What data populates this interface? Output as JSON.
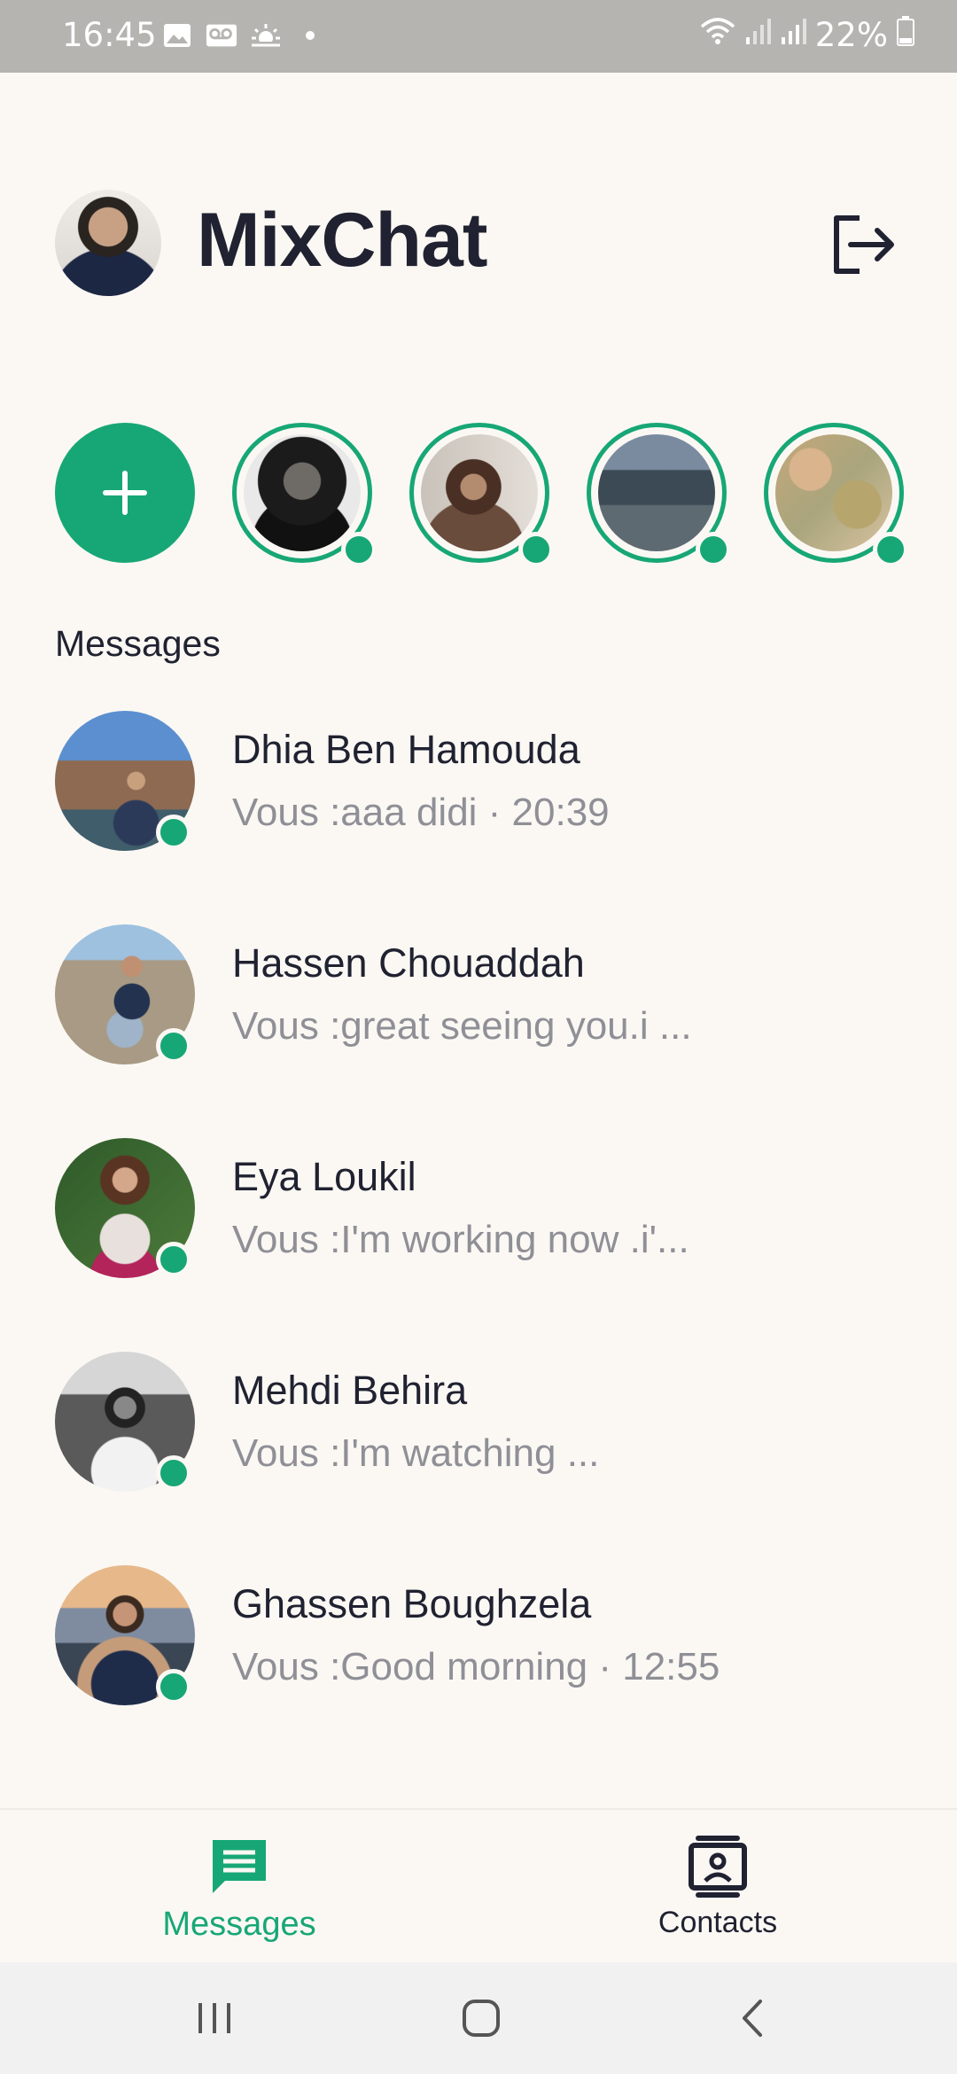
{
  "status_bar": {
    "time": "16:45",
    "battery": "22%",
    "icons_left": [
      "image-icon",
      "voicemail-icon",
      "weather-icon",
      "dot-icon"
    ],
    "icons_right": [
      "wifi-icon",
      "signal-icon",
      "signal-icon",
      "battery-icon"
    ]
  },
  "header": {
    "title": "MixChat",
    "logout_icon": "logout-icon"
  },
  "stories": {
    "add_icon": "plus-icon",
    "items": [
      {
        "online": true
      },
      {
        "online": true
      },
      {
        "online": true
      },
      {
        "online": true
      }
    ]
  },
  "section": {
    "title": "Messages"
  },
  "conversations": [
    {
      "name": "Dhia Ben Hamouda",
      "preview": "Vous :aaa didi  · 20:39",
      "online": true
    },
    {
      "name": "Hassen Chouaddah",
      "preview": "Vous :great seeing you.i ...",
      "online": true
    },
    {
      "name": "Eya Loukil",
      "preview": "Vous :I'm working now .i'...",
      "online": true
    },
    {
      "name": "Mehdi Behira",
      "preview": "Vous :I'm watching ...",
      "online": true
    },
    {
      "name": "Ghassen Boughzela",
      "preview": "Vous :Good morning · 12:55",
      "online": true
    }
  ],
  "bottom_nav": {
    "messages_label": "Messages",
    "contacts_label": "Contacts",
    "active": "Messages"
  },
  "colors": {
    "accent": "#17A776",
    "background": "#FBF8F4",
    "text": "#202231",
    "muted": "#8F8F96"
  }
}
